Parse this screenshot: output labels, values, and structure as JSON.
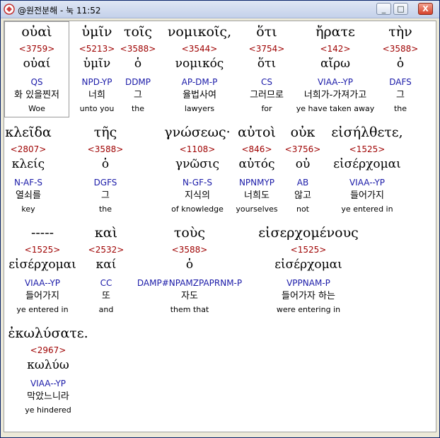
{
  "window": {
    "title": "@원전분해 - 눅 11:52",
    "buttons": {
      "minimize": "_",
      "maximize": "□",
      "close": "X"
    }
  },
  "rows": [
    [
      {
        "greek": "οὐαὶ",
        "strong": "<3759>",
        "lemma": "οὐαί",
        "parse": "QS",
        "korean": "화 있을찐저",
        "english": "Woe"
      },
      {
        "greek": "ὑμῖν",
        "strong": "<5213>",
        "lemma": "ὑμῖν",
        "parse": "NPD-YP",
        "korean": "너희",
        "english": "unto you"
      },
      {
        "greek": "τοῖς",
        "strong": "<3588>",
        "lemma": "ὁ",
        "parse": "DDMP",
        "korean": "그",
        "english": "the"
      },
      {
        "greek": "νομικοῖς,",
        "strong": "<3544>",
        "lemma": "νομικός",
        "parse": "AP-DM-P",
        "korean": "율법사여",
        "english": "lawyers"
      },
      {
        "greek": "ὅτι",
        "strong": "<3754>",
        "lemma": "ὅτι",
        "parse": "CS",
        "korean": "그러므로",
        "english": "for"
      },
      {
        "greek": "ἤρατε",
        "strong": "<142>",
        "lemma": "αἴρω",
        "parse": "VIAA--YP",
        "korean": "너희가-가져가고",
        "english": "ye have taken away"
      },
      {
        "greek": "τὴν",
        "strong": "<3588>",
        "lemma": "ὁ",
        "parse": "DAFS",
        "korean": "그",
        "english": "the"
      }
    ],
    [
      {
        "greek": "κλεῖδα",
        "strong": "<2807>",
        "lemma": "κλείς",
        "parse": "N-AF-S",
        "korean": "열쇠를",
        "english": "key"
      },
      {
        "greek": "τῆς",
        "strong": "<3588>",
        "lemma": "ὁ",
        "parse": "DGFS",
        "korean": "그",
        "english": "the"
      },
      {
        "greek": "γνώσεως·",
        "strong": "<1108>",
        "lemma": "γνῶσις",
        "parse": "N-GF-S",
        "korean": "지식의",
        "english": "of knowledge"
      },
      {
        "greek": "αὐτοὶ",
        "strong": "<846>",
        "lemma": "αὐτός",
        "parse": "NPNMYP",
        "korean": "너희도",
        "english": "yourselves"
      },
      {
        "greek": "οὐκ",
        "strong": "<3756>",
        "lemma": "οὐ",
        "parse": "AB",
        "korean": "않고",
        "english": "not"
      },
      {
        "greek": "εἰσήλθετε,",
        "strong": "<1525>",
        "lemma": "εἰσέρχομαι",
        "parse": "VIAA--YP",
        "korean": "들어가지",
        "english": "ye entered in"
      }
    ],
    [
      {
        "greek": "-----",
        "strong": "<1525>",
        "lemma": "εἰσέρχομαι",
        "parse": "VIAA--YP",
        "korean": "들어가지",
        "english": "ye entered in"
      },
      {
        "greek": "καὶ",
        "strong": "<2532>",
        "lemma": "καί",
        "parse": "CC",
        "korean": "또",
        "english": "and"
      },
      {
        "greek": "τοὺς",
        "strong": "<3588>",
        "lemma": "ὁ",
        "parse": "DAMP#NPAMZPAPRNM-P",
        "korean": "자도",
        "english": "them that"
      },
      {
        "greek": "εἰσερχομένους",
        "strong": "<1525>",
        "lemma": "εἰσέρχομαι",
        "parse": "VPPNAM-P",
        "korean": "들어가자 하는",
        "english": "were entering in"
      }
    ],
    [
      {
        "greek": "ἐκωλύσατε.",
        "strong": "<2967>",
        "lemma": "κωλύω",
        "parse": "VIAA--YP",
        "korean": "막았느니라",
        "english": "ye hindered"
      }
    ]
  ]
}
